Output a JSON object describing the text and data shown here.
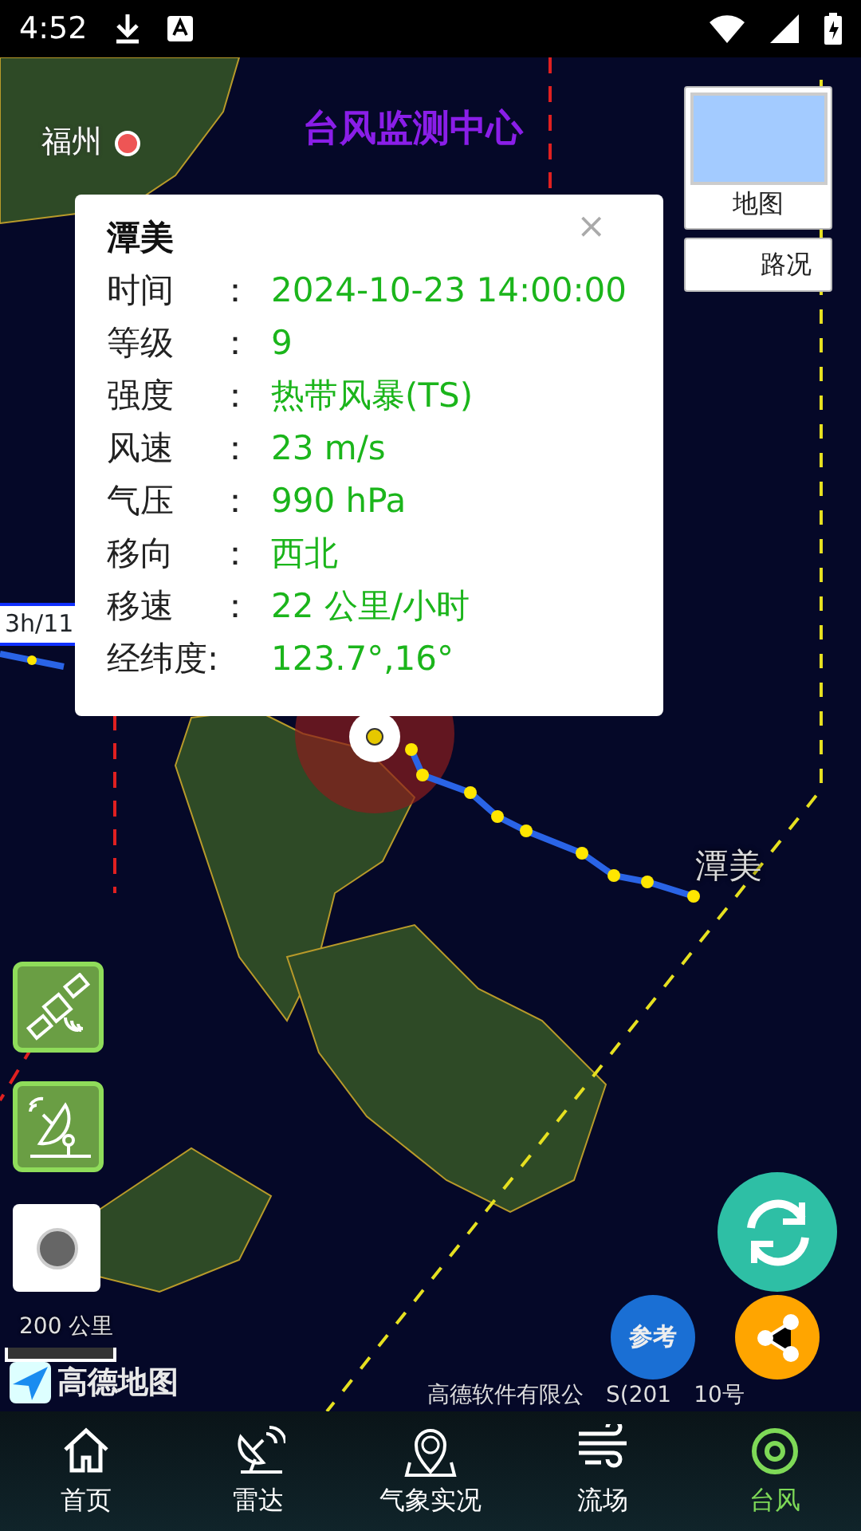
{
  "status_bar": {
    "time": "4:52"
  },
  "map": {
    "city_label": "福州",
    "title": "台风监测中心",
    "side_label": "3h/11",
    "track_label": "潭美",
    "layer_buttons": [
      {
        "label": "地图",
        "kind": "thumb"
      },
      {
        "label": "路况",
        "kind": "plain"
      }
    ],
    "popup": {
      "name": "潭美",
      "close": "×",
      "rows": [
        {
          "label": "时间",
          "separator": "：",
          "value": "2024-10-23 14:00:00"
        },
        {
          "label": "等级",
          "separator": "：",
          "value": "9"
        },
        {
          "label": "强度",
          "separator": "：",
          "value": "热带风暴(TS)"
        },
        {
          "label": "风速",
          "separator": "：",
          "value": "23 m/s"
        },
        {
          "label": "气压",
          "separator": "：",
          "value": "990 hPa"
        },
        {
          "label": "移向",
          "separator": "：",
          "value": "西北"
        },
        {
          "label": "移速",
          "separator": "：",
          "value": "22 公里/小时"
        },
        {
          "label": "经纬度:",
          "value": "123.7°,16°"
        }
      ]
    },
    "scale": "200 公里",
    "logo_text": "高德地图",
    "attribution": [
      "高德软件有限公",
      "S(201",
      "10号"
    ],
    "reference_button": "参考"
  },
  "nav": [
    {
      "label": "首页",
      "selected": false
    },
    {
      "label": "雷达",
      "selected": false
    },
    {
      "label": "气象实况",
      "selected": false
    },
    {
      "label": "流场",
      "selected": false
    },
    {
      "label": "台风",
      "selected": true
    }
  ]
}
